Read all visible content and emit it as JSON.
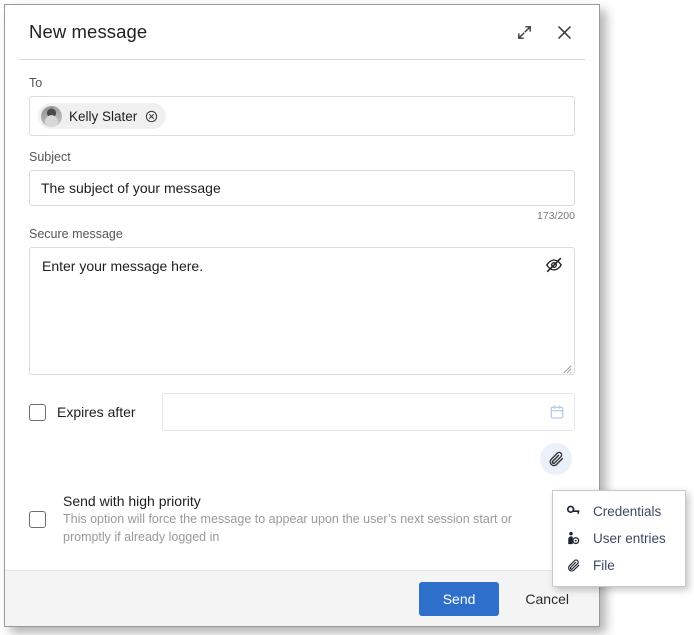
{
  "dialog": {
    "title": "New message",
    "expand_icon": "expand-diagonal-icon",
    "close_icon": "close-icon"
  },
  "to": {
    "label": "To",
    "recipients": [
      {
        "name": "Kelly Slater",
        "remove_icon": "remove-circle-icon",
        "avatar": "avatar-photo"
      }
    ]
  },
  "subject": {
    "label": "Subject",
    "value": "The subject of your message",
    "counter": "173/200"
  },
  "message": {
    "label": "Secure message",
    "value": "Enter your message here.",
    "visibility_icon": "eye-off-icon"
  },
  "expires": {
    "label": "Expires after",
    "checked": false,
    "date_value": "",
    "calendar_icon": "calendar-icon"
  },
  "attach": {
    "button_icon": "paperclip-icon",
    "menu": [
      {
        "label": "Credentials",
        "icon": "key-icon"
      },
      {
        "label": "User entries",
        "icon": "user-entries-icon"
      },
      {
        "label": "File",
        "icon": "paperclip-icon"
      }
    ]
  },
  "priority": {
    "title": "Send with high priority",
    "description": "This option will force the message to appear upon the user’s next session start or promptly if already logged in",
    "checked": false
  },
  "footer": {
    "send_label": "Send",
    "cancel_label": "Cancel"
  },
  "colors": {
    "accent": "#2d6fca",
    "footer_bg": "#f4f4f4",
    "calendar_icon": "#b5cbe8",
    "attach_bg": "#eaf1fa",
    "menu_text": "#3b4a63"
  }
}
